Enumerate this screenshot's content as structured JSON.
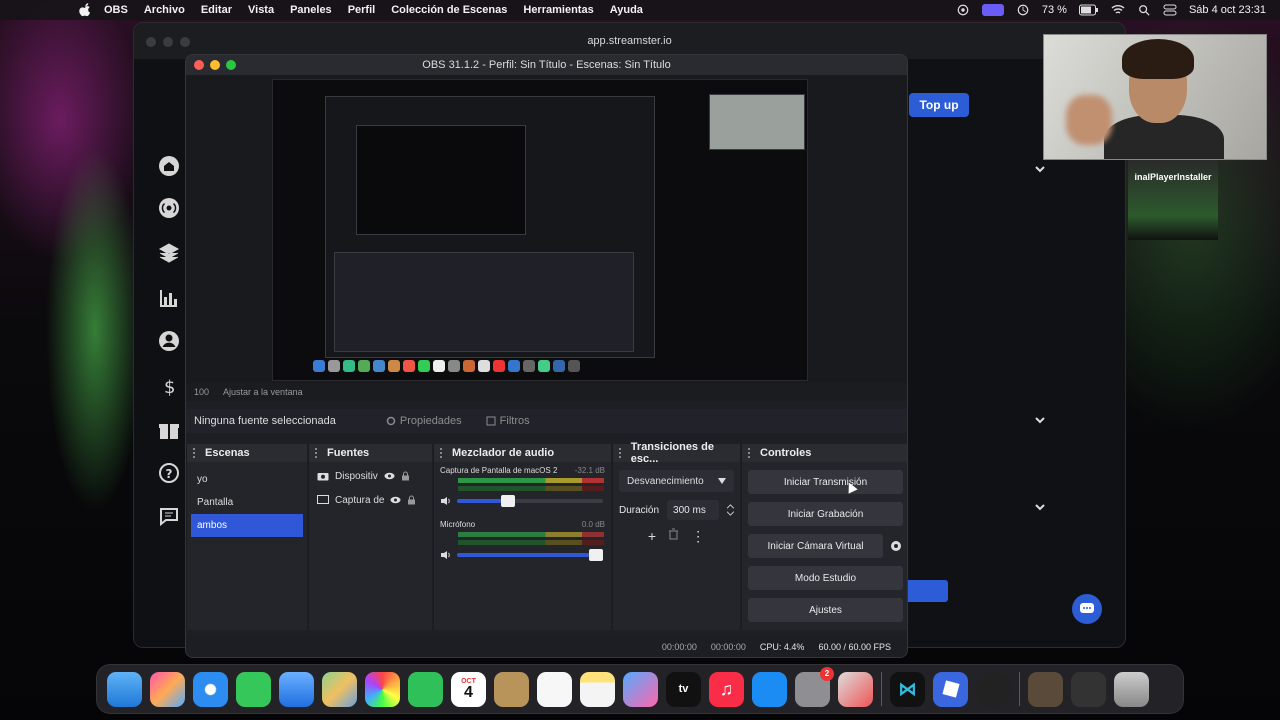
{
  "menubar": {
    "items": [
      "OBS",
      "Archivo",
      "Editar",
      "Vista",
      "Paneles",
      "Perfil",
      "Colección de Escenas",
      "Herramientas",
      "Ayuda"
    ],
    "battery": "73 %",
    "datetime": "Sáb 4 oct 23:31"
  },
  "browser": {
    "url": "app.streamster.io",
    "topup_label": "Top up",
    "player_label": "inalPlayerInstaller",
    "nav_icons": [
      "home-icon",
      "broadcast-icon",
      "layers-icon",
      "stats-icon",
      "user-icon",
      "dollar-icon",
      "gift-icon",
      "help-icon",
      "chat-icon"
    ]
  },
  "obs": {
    "title": "OBS 31.1.2 - Perfil: Sin Título - Escenas: Sin Título",
    "preview_bar": {
      "zoom": "100",
      "fit_label": "Ajustar a la ventana"
    },
    "source_bar": {
      "no_source": "Ninguna fuente seleccionada",
      "properties": "Propiedades",
      "filters": "Filtros"
    },
    "scenes": {
      "title": "Escenas",
      "items": [
        "yo",
        "Pantalla",
        "ambos"
      ],
      "selected_index": 2
    },
    "sources": {
      "title": "Fuentes",
      "items": [
        "Dispositiv",
        "Captura de"
      ]
    },
    "mixer": {
      "title": "Mezclador de audio",
      "channels": [
        {
          "name": "Captura de Pantalla de macOS 2",
          "db": "-32.1 dB",
          "volume": 0.4
        },
        {
          "name": "Micrófono",
          "db": "0.0 dB",
          "volume": 1.0
        }
      ]
    },
    "transitions": {
      "title": "Transiciones de esc...",
      "selected": "Desvanecimiento",
      "duration_label": "Duración",
      "duration_value": "300 ms"
    },
    "controls": {
      "title": "Controles",
      "start_stream": "Iniciar Transmisión",
      "start_record": "Iniciar Grabación",
      "start_virtual_cam": "Iniciar Cámara Virtual",
      "studio_mode": "Modo Estudio",
      "settings": "Ajustes"
    },
    "status": {
      "stream_time": "00:00:00",
      "record_time": "00:00:00",
      "cpu": "CPU: 4.4%",
      "fps": "60.00 / 60.00 FPS"
    }
  },
  "dock": {
    "calendar_day": "4",
    "calendar_month": "OCT",
    "badge_count": "2",
    "appletv_label": "tv"
  },
  "colors": {
    "accent": "#2f57d8",
    "topup": "#2c5cd6"
  }
}
